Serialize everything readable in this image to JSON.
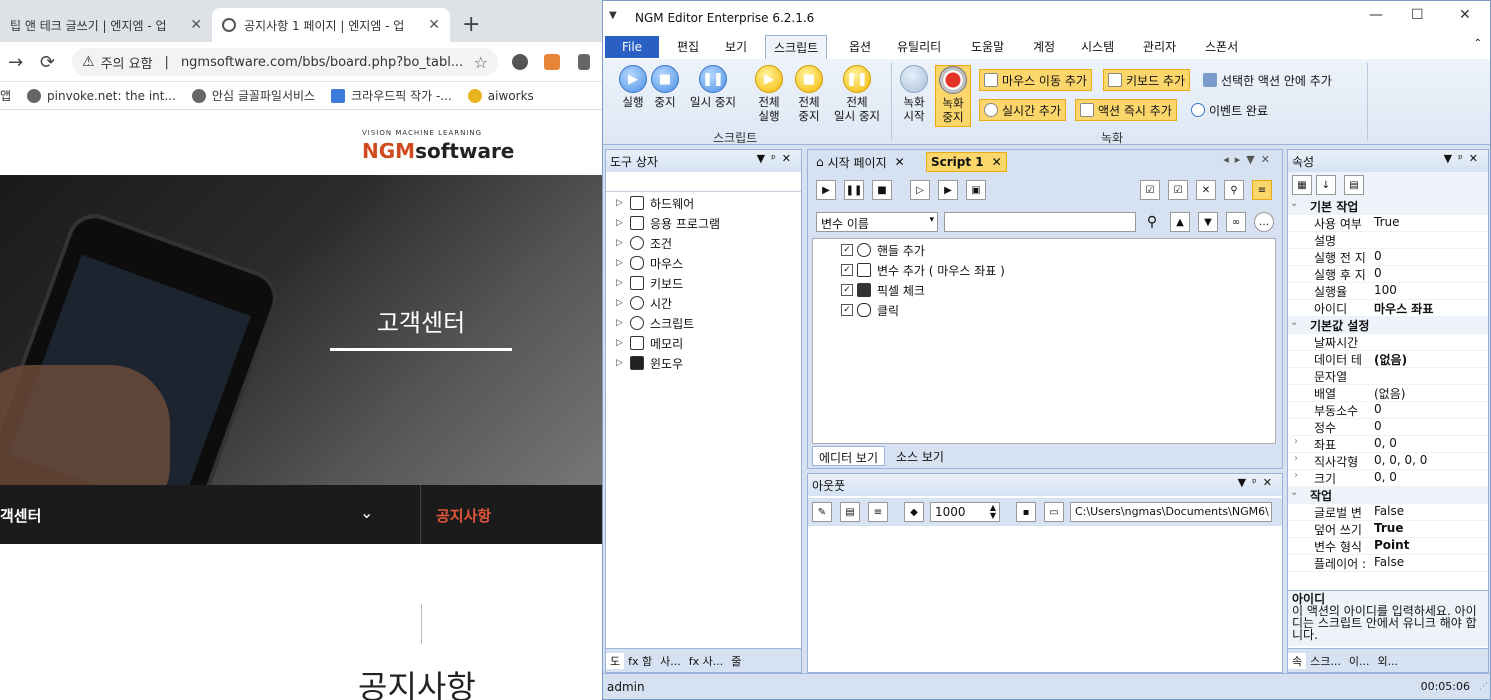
{
  "browser": {
    "tabs": [
      {
        "title": "팁 앤 테크 글쓰기 | 엔지엠 - 업",
        "close": "✕"
      },
      {
        "title": "공지사항 1 페이지 | 엔지엠 - 업",
        "close": "✕"
      }
    ],
    "new_tab": "+",
    "nav": {
      "forward": "→",
      "reload": "⟳"
    },
    "omnibox": {
      "security": "주의 요함",
      "separator": "|",
      "url": "ngmsoftware.com/bbs/board.php?bo_tabl...",
      "star": "☆"
    },
    "bookmarks": [
      "앱",
      "pinvoke.net: the int...",
      "안심 글꼴파일서비스",
      "크라우드픽 작가 -...",
      "aiworks"
    ]
  },
  "site": {
    "logo_small": "VISION MACHINE LEARNING",
    "logo_ngm": "NGM",
    "logo_software": "software",
    "hero_title": "고객센터",
    "subnav_left": "객센터",
    "subnav_chevron": "⌄",
    "subnav_right": "공지사항",
    "page_title": "공지사항"
  },
  "editor": {
    "title": "NGM Editor   Enterprise 6.2.1.6",
    "quick_access": "▼",
    "window_controls": {
      "min": "—",
      "max": "☐",
      "close": "✕"
    },
    "menu": [
      "File",
      "편집",
      "보기",
      "스크립트",
      "옵션",
      "유틸리티",
      "도움말",
      "계정",
      "시스템",
      "관리자",
      "스폰서"
    ],
    "menu_active_index": 3,
    "menu_collapse": "⌃",
    "ribbon": {
      "script_buttons": [
        {
          "label": "실행",
          "glyph": "▶"
        },
        {
          "label": "중지",
          "glyph": "■"
        },
        {
          "label": "일시 중지",
          "glyph": "❚❚"
        },
        {
          "label": "전체\n실행",
          "glyph": "▶"
        },
        {
          "label": "전체\n중지",
          "glyph": "■"
        },
        {
          "label": "전체\n일시 중지",
          "glyph": "❚❚"
        }
      ],
      "group_script": "스크립트",
      "record_buttons": [
        {
          "label": "녹화\n시작"
        },
        {
          "label": "녹화\n중지"
        }
      ],
      "record_small": [
        "마우스 이동 추가",
        "키보드 추가",
        "선택한 액션 안에 추가",
        "실시간 추가",
        "액션 즉시 추가",
        "이벤트 완료"
      ],
      "group_record": "녹화"
    },
    "toolbox": {
      "title": "도구 상자",
      "items": [
        "하드웨어",
        "응용 프로그램",
        "조건",
        "마우스",
        "키보드",
        "시간",
        "스크립트",
        "메모리",
        "윈도우"
      ],
      "bottom_tabs": [
        "도",
        "fx 함",
        "사...",
        "fx 사...",
        "줄"
      ]
    },
    "script": {
      "tabs": [
        "시작 페이지",
        "Script 1"
      ],
      "var_select": "변수 이름",
      "actions": [
        "핸들 추가",
        "변수 추가 ( 마우스 좌표 )",
        "픽셀 체크",
        "클릭"
      ],
      "view_tabs": [
        "에디터 보기",
        "소스 보기"
      ]
    },
    "output": {
      "title": "아웃풋",
      "count": "1000",
      "path": "C:\\Users\\ngmas\\Documents\\NGM6\\"
    },
    "properties": {
      "title": "속성",
      "rows": [
        {
          "cat": true,
          "name": "기본 작업"
        },
        {
          "name": "사용 여부",
          "value": "True"
        },
        {
          "name": "설명",
          "value": ""
        },
        {
          "name": "실행 전 지",
          "value": "0"
        },
        {
          "name": "실행 후 지",
          "value": "0"
        },
        {
          "name": "실행율",
          "value": "100"
        },
        {
          "name": "아이디",
          "value": "마우스 좌표",
          "bold": true
        },
        {
          "cat": true,
          "name": "기본값 설정"
        },
        {
          "name": "날짜시간",
          "value": ""
        },
        {
          "name": "데이터 테",
          "value": "(없음)",
          "bold": true
        },
        {
          "name": "문자열",
          "value": ""
        },
        {
          "name": "배열",
          "value": "(없음)"
        },
        {
          "name": "부동소수",
          "value": "0"
        },
        {
          "name": "정수",
          "value": "0"
        },
        {
          "name": "좌표",
          "value": "0, 0",
          "expand": true
        },
        {
          "name": "직사각형",
          "value": "0, 0, 0, 0",
          "expand": true
        },
        {
          "name": "크기",
          "value": "0, 0",
          "expand": true
        },
        {
          "cat": true,
          "name": "작업"
        },
        {
          "name": "글로벌 변",
          "value": "False"
        },
        {
          "name": "덮어 쓰기",
          "value": "True",
          "bold": true
        },
        {
          "name": "변수 형식",
          "value": "Point",
          "bold": true
        },
        {
          "name": "플레이어 :",
          "value": "False"
        }
      ],
      "desc_title": "아이디",
      "desc_text": "이 액션의 아이디를 입력하세요. 아이디는 스크립트 안에서 유니크 해야 합니다.",
      "bottom_tabs": [
        "속",
        "스크...",
        "이...",
        "외..."
      ]
    },
    "status": {
      "user": "admin",
      "time": "00:05:06"
    }
  }
}
